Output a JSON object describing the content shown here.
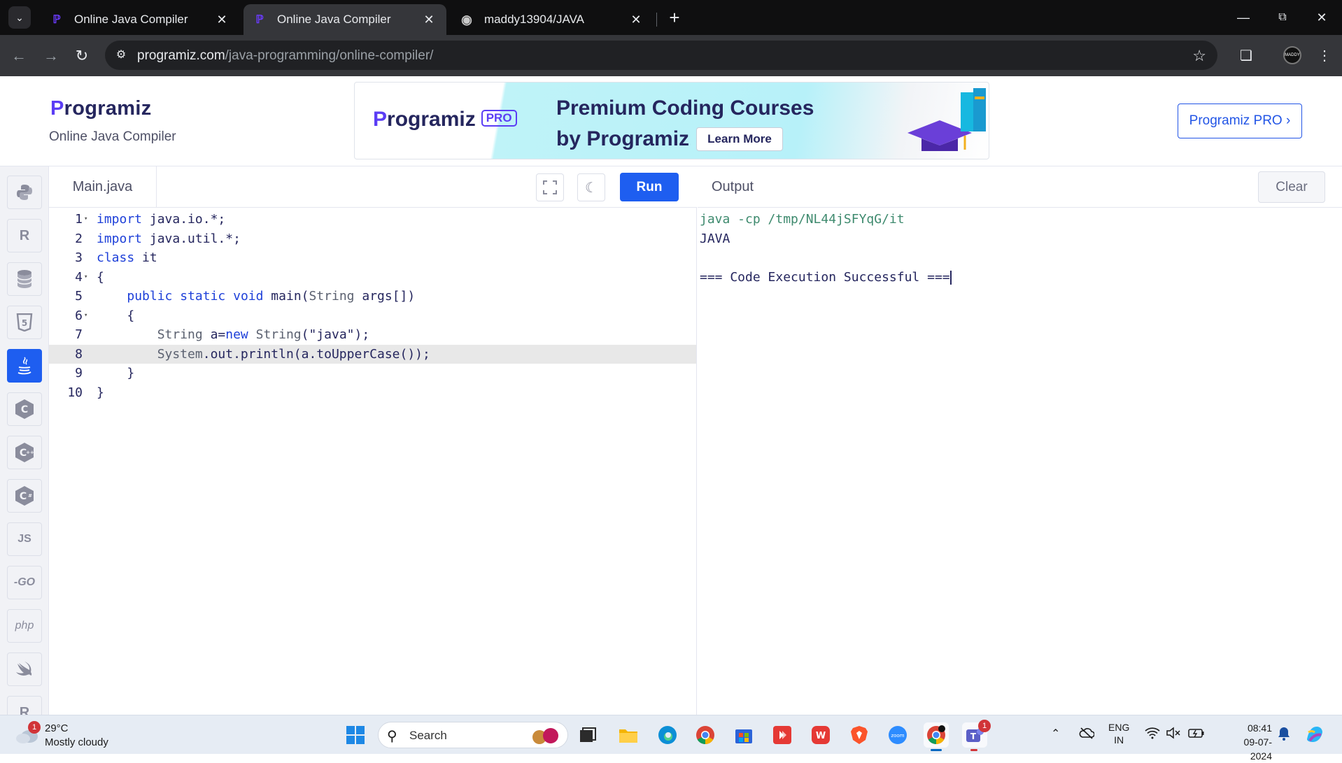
{
  "browser": {
    "tabs": [
      {
        "title": "Online Java Compiler",
        "favicon": "programiz-icon",
        "active": false
      },
      {
        "title": "Online Java Compiler",
        "favicon": "programiz-icon",
        "active": true
      },
      {
        "title": "maddy13904/JAVA",
        "favicon": "github-icon",
        "active": false
      }
    ],
    "url_host": "programiz.com",
    "url_path": "/java-programming/online-compiler/",
    "profile_label": "MADDY"
  },
  "site": {
    "brand": "rogramiz",
    "brand_initial": "P",
    "subtitle": "Online Java Compiler",
    "banner": {
      "logo_text": "rogramiz",
      "logo_initial": "P",
      "pro_badge": "PRO",
      "line1": "Premium Coding Courses",
      "line2": "by Programiz",
      "cta": "Learn More"
    },
    "pro_button": "Programiz PRO ›"
  },
  "languages": [
    {
      "name": "python-icon",
      "label": "",
      "active": false
    },
    {
      "name": "r-icon",
      "label": "R",
      "active": false
    },
    {
      "name": "sql-icon",
      "label": "",
      "active": false
    },
    {
      "name": "html-icon",
      "label": "5",
      "active": false
    },
    {
      "name": "java-icon",
      "label": "",
      "active": true
    },
    {
      "name": "c-icon",
      "label": "C",
      "active": false
    },
    {
      "name": "cpp-icon",
      "label": "C",
      "active": false
    },
    {
      "name": "csharp-icon",
      "label": "C",
      "active": false
    },
    {
      "name": "js-icon",
      "label": "JS",
      "active": false
    },
    {
      "name": "go-icon",
      "label": "-GO",
      "active": false
    },
    {
      "name": "php-icon",
      "label": "php",
      "active": false
    },
    {
      "name": "swift-icon",
      "label": "",
      "active": false
    },
    {
      "name": "rust-icon",
      "label": "R",
      "active": false
    }
  ],
  "editor": {
    "file_name": "Main.java",
    "run_label": "Run",
    "current_line": 8,
    "lines": [
      {
        "n": "1",
        "fold": true,
        "html": "<span class=\"kw\">import</span> java.io.*;"
      },
      {
        "n": "2",
        "fold": false,
        "html": "<span class=\"kw\">import</span> java.util.*;"
      },
      {
        "n": "3",
        "fold": false,
        "html": "<span class=\"kw\">class</span> it"
      },
      {
        "n": "4",
        "fold": true,
        "html": "{"
      },
      {
        "n": "5",
        "fold": false,
        "html": "    <span class=\"kw\">public</span> <span class=\"kw\">static</span> <span class=\"kw\">void</span> main(<span class=\"ty\">String</span> args[])"
      },
      {
        "n": "6",
        "fold": true,
        "html": "    {"
      },
      {
        "n": "7",
        "fold": false,
        "html": "        <span class=\"ty\">String</span> a=<span class=\"kw\">new</span> <span class=\"ty\">String</span>(<span class=\"str\">\"java\"</span>);"
      },
      {
        "n": "8",
        "fold": false,
        "html": "        <span class=\"ty\">System</span>.out.println(a.toUpperCase());"
      },
      {
        "n": "9",
        "fold": false,
        "html": "    }"
      },
      {
        "n": "10",
        "fold": false,
        "html": "}"
      }
    ]
  },
  "output": {
    "title": "Output",
    "clear_label": "Clear",
    "lines": [
      {
        "text": "java -cp /tmp/NL44jSFYqG/it",
        "type": "cmd"
      },
      {
        "text": "JAVA",
        "type": "out"
      },
      {
        "text": "",
        "type": "out"
      },
      {
        "text": "=== Code Execution Successful ===",
        "type": "out"
      }
    ]
  },
  "taskbar": {
    "weather_badge": "1",
    "temperature": "29°C",
    "condition": "Mostly cloudy",
    "search_placeholder": "Search",
    "teams_badge": "1",
    "lang_line1": "ENG",
    "lang_line2": "IN",
    "time": "08:41",
    "date": "09-07-2024"
  }
}
